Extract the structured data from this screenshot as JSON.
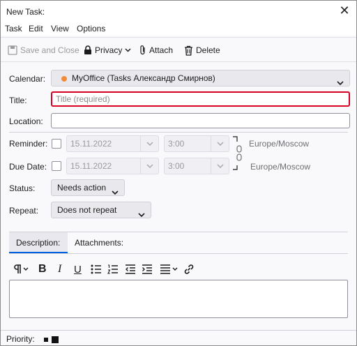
{
  "window": {
    "title": "New Task:"
  },
  "menu": [
    "Task",
    "Edit",
    "View",
    "Options"
  ],
  "toolbar": {
    "save_close": "Save and Close",
    "privacy": "Privacy",
    "attach": "Attach",
    "delete": "Delete"
  },
  "form": {
    "calendar_label": "Calendar:",
    "calendar_value": "MyOffice (Tasks Александр Смирнов)",
    "calendar_color": "#f08c3a",
    "title_label": "Title:",
    "title_placeholder": "Title (required)",
    "location_label": "Location:",
    "location_value": "",
    "reminder_label": "Reminder:",
    "reminder_date": "15.11.2022",
    "reminder_time": "3:00",
    "reminder_tz": "Europe/Moscow",
    "due_label": "Due Date:",
    "due_date": "15.11.2022",
    "due_time": "3:00",
    "due_tz": "Europe/Moscow",
    "status_label": "Status:",
    "status_value": "Needs action",
    "repeat_label": "Repeat:",
    "repeat_value": "Does not repeat"
  },
  "tabs": [
    "Description:",
    "Attachments:"
  ],
  "statusbar": {
    "priority_label": "Priority:"
  },
  "colors": {
    "accent": "#0061e0",
    "required_border": "#d70022"
  }
}
